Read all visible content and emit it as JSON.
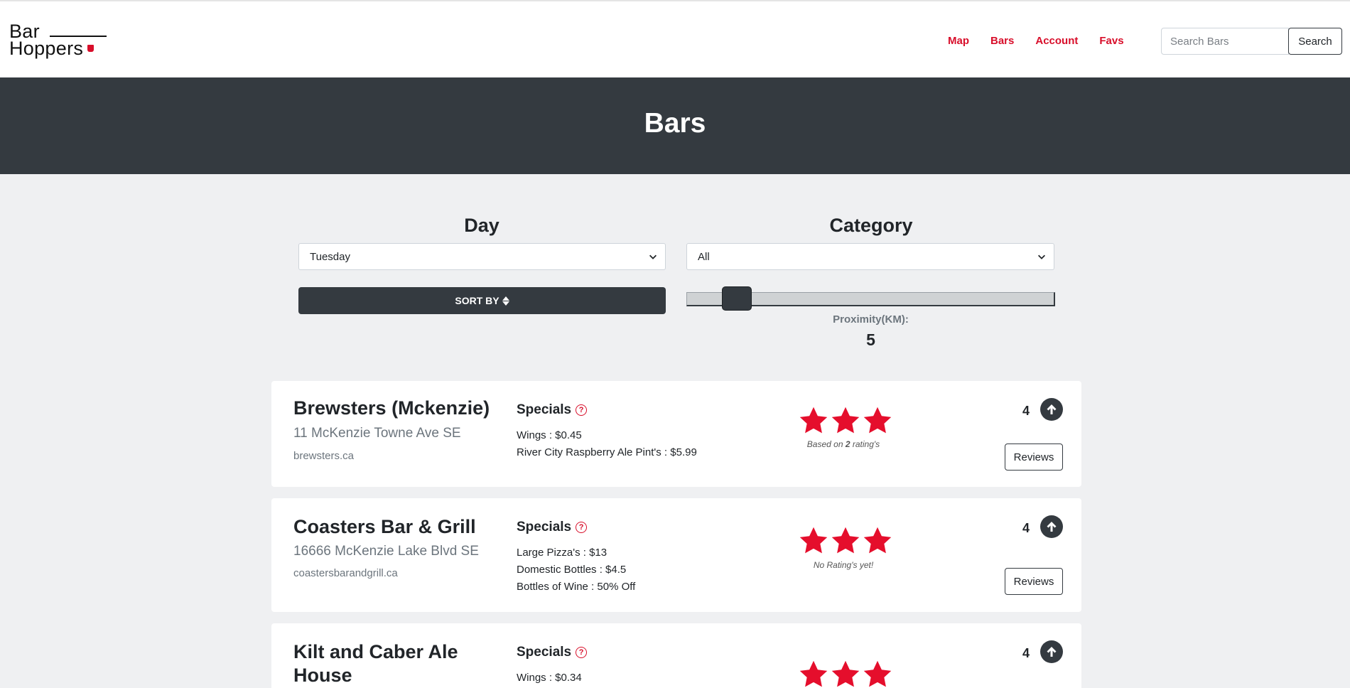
{
  "header": {
    "logo": {
      "line1": "Bar",
      "line2": "Hoppers"
    },
    "nav": [
      "Map",
      "Bars",
      "Account",
      "Favs"
    ],
    "search": {
      "placeholder": "Search Bars",
      "button_label": "Search"
    }
  },
  "hero": {
    "title": "Bars"
  },
  "filters": {
    "day": {
      "label": "Day",
      "selected": "Tuesday"
    },
    "category": {
      "label": "Category",
      "selected": "All"
    },
    "sort_label": "SORT BY",
    "proximity": {
      "label": "Proximity(KM):",
      "value": "5",
      "slider_fraction": 0.105
    }
  },
  "bars": [
    {
      "name": "Brewsters (Mckenzie)",
      "address": "11 McKenzie Towne Ave SE",
      "website": "brewsters.ca",
      "specials_title": "Specials",
      "specials": [
        "Wings : $0.45",
        "River City Raspberry Ale Pint's : $5.99"
      ],
      "stars": 3,
      "rating_note_prefix": "Based on ",
      "rating_count": "2",
      "rating_note_suffix": " rating's",
      "votes": "4",
      "reviews_label": "Reviews"
    },
    {
      "name": "Coasters Bar & Grill",
      "address": "16666 McKenzie Lake Blvd SE",
      "website": "coastersbarandgrill.ca",
      "specials_title": "Specials",
      "specials": [
        "Large Pizza's : $13",
        "Domestic Bottles : $4.5",
        "Bottles of Wine : 50% Off"
      ],
      "stars": 3,
      "rating_note": "No Rating's yet!",
      "votes": "4",
      "reviews_label": "Reviews"
    },
    {
      "name": "Kilt and Caber Ale House",
      "specials_title": "Specials",
      "specials": [
        "Wings : $0.34"
      ],
      "stars": 3,
      "votes": "4"
    }
  ],
  "icons": {
    "star": "star-icon",
    "vote": "arrow-up-circle-icon",
    "help": "question-circle-icon",
    "sort": "sort-icon",
    "chevron": "chevron-down-icon"
  },
  "colors": {
    "accent": "#d80e2a",
    "dark": "#343a40",
    "background": "#eff0f2",
    "star": "#e50e2c"
  }
}
